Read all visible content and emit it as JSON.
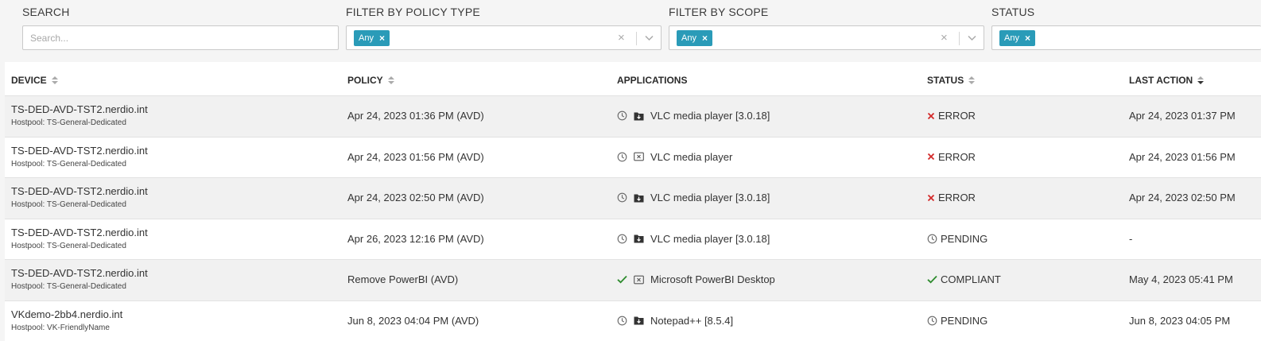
{
  "filters": {
    "search": {
      "label": "SEARCH",
      "placeholder": "Search..."
    },
    "policy_type": {
      "label": "FILTER BY POLICY TYPE",
      "chip": "Any"
    },
    "scope": {
      "label": "FILTER BY SCOPE",
      "chip": "Any"
    },
    "status": {
      "label": "STATUS",
      "chip": "Any"
    }
  },
  "columns": {
    "device": "DEVICE",
    "policy": "POLICY",
    "applications": "APPLICATIONS",
    "status": "STATUS",
    "last_action": "LAST ACTION"
  },
  "colors": {
    "chip": "#2a9bb8",
    "error": "#d32a2a",
    "compliant": "#2e8b2e"
  },
  "rows": [
    {
      "device": "TS-DED-AVD-TST2.nerdio.int",
      "hostpool": "Hostpool: TS-General-Dedicated",
      "policy": "Apr 24, 2023 01:36 PM (AVD)",
      "app_state_icon": "clock-icon",
      "app_type_icon": "folder-download-icon",
      "application": "VLC media player [3.0.18]",
      "status_icon": "error-x-icon",
      "status": "ERROR",
      "last_action": "Apr 24, 2023 01:37 PM"
    },
    {
      "device": "TS-DED-AVD-TST2.nerdio.int",
      "hostpool": "Hostpool: TS-General-Dedicated",
      "policy": "Apr 24, 2023 01:56 PM (AVD)",
      "app_state_icon": "clock-icon",
      "app_type_icon": "uninstall-box-icon",
      "application": "VLC media player",
      "status_icon": "error-x-icon",
      "status": "ERROR",
      "last_action": "Apr 24, 2023 01:56 PM"
    },
    {
      "device": "TS-DED-AVD-TST2.nerdio.int",
      "hostpool": "Hostpool: TS-General-Dedicated",
      "policy": "Apr 24, 2023 02:50 PM (AVD)",
      "app_state_icon": "clock-icon",
      "app_type_icon": "folder-download-icon",
      "application": "VLC media player [3.0.18]",
      "status_icon": "error-x-icon",
      "status": "ERROR",
      "last_action": "Apr 24, 2023 02:50 PM"
    },
    {
      "device": "TS-DED-AVD-TST2.nerdio.int",
      "hostpool": "Hostpool: TS-General-Dedicated",
      "policy": "Apr 26, 2023 12:16 PM (AVD)",
      "app_state_icon": "clock-icon",
      "app_type_icon": "folder-download-icon",
      "application": "VLC media player [3.0.18]",
      "status_icon": "clock-icon",
      "status": "PENDING",
      "last_action": "-"
    },
    {
      "device": "TS-DED-AVD-TST2.nerdio.int",
      "hostpool": "Hostpool: TS-General-Dedicated",
      "policy": "Remove PowerBI (AVD)",
      "app_state_icon": "check-icon",
      "app_type_icon": "uninstall-box-icon",
      "application": "Microsoft PowerBI Desktop",
      "status_icon": "check-icon",
      "status": "COMPLIANT",
      "last_action": "May 4, 2023 05:41 PM"
    },
    {
      "device": "VKdemo-2bb4.nerdio.int",
      "hostpool": "Hostpool: VK-FriendlyName",
      "policy": "Jun 8, 2023 04:04 PM (AVD)",
      "app_state_icon": "clock-icon",
      "app_type_icon": "folder-download-icon",
      "application": "Notepad++ [8.5.4]",
      "status_icon": "clock-icon",
      "status": "PENDING",
      "last_action": "Jun 8, 2023 04:05 PM"
    }
  ]
}
